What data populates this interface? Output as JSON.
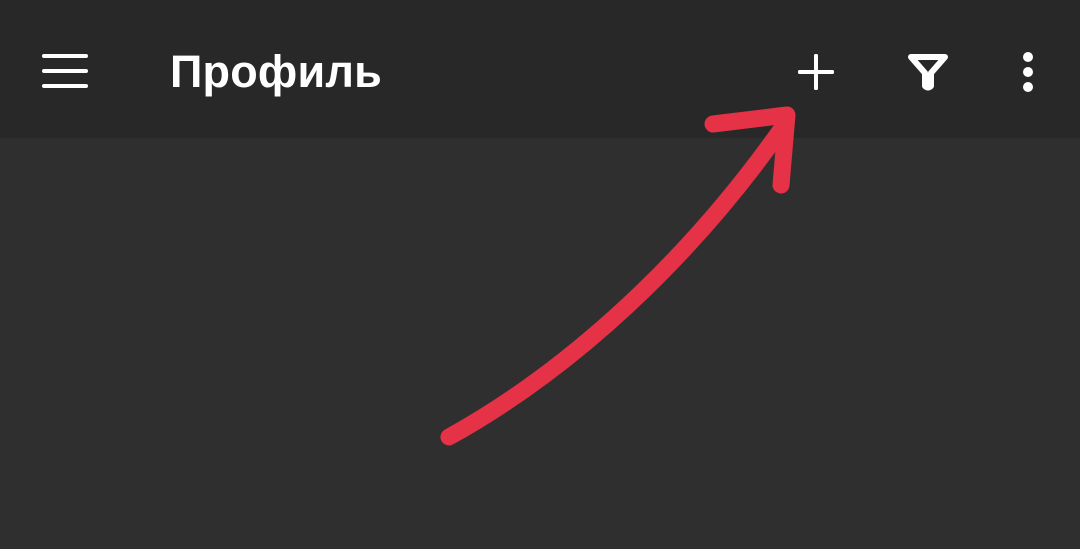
{
  "app_bar": {
    "title": "Профиль",
    "menu_icon": "menu-icon",
    "add_icon": "plus-icon",
    "filter_icon": "filter-icon",
    "more_icon": "more-vertical-icon",
    "background_color": "#282828",
    "icon_color": "#ffffff"
  },
  "content": {
    "background_color": "#2f2f2f"
  },
  "annotation": {
    "type": "arrow",
    "color": "#e63246",
    "points_to": "add-button"
  }
}
